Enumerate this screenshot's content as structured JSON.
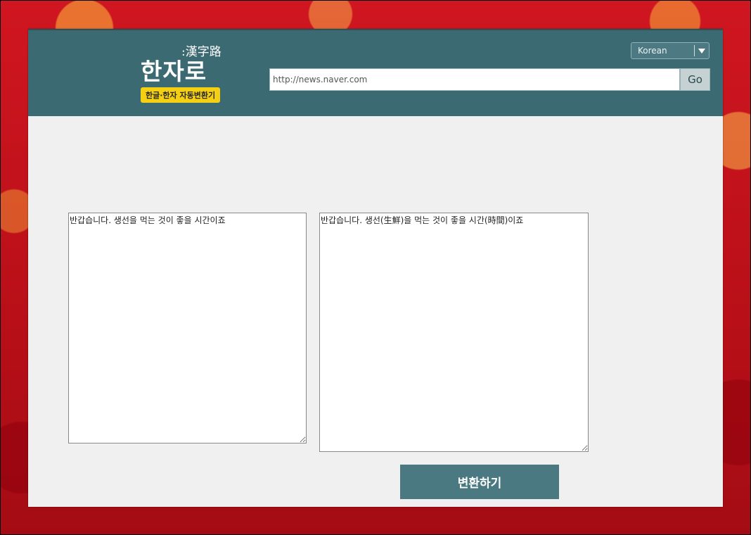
{
  "header": {
    "logo": {
      "hanja": ":漢字路",
      "title": "한자로",
      "tagline": "한글·한자 자동변환기"
    },
    "language_select": {
      "value": "Korean"
    },
    "url_input": {
      "value": "http://news.naver.com"
    },
    "go_label": "Go"
  },
  "main": {
    "source_text": "반갑습니다. 생선을 먹는 것이 좋을 시간이죠",
    "result_text": "반갑습니다. 생선(生鮮)을 먹는 것이 좋을 시간(時間)이죠",
    "convert_label": "변환하기"
  },
  "colors": {
    "header_bg": "#3b6a73",
    "badge_bg": "#f5d012",
    "button_bg": "#4a7982",
    "panel_bg": "#f0f0f0"
  },
  "icons": {
    "dropdown": "chevron-down-icon"
  }
}
